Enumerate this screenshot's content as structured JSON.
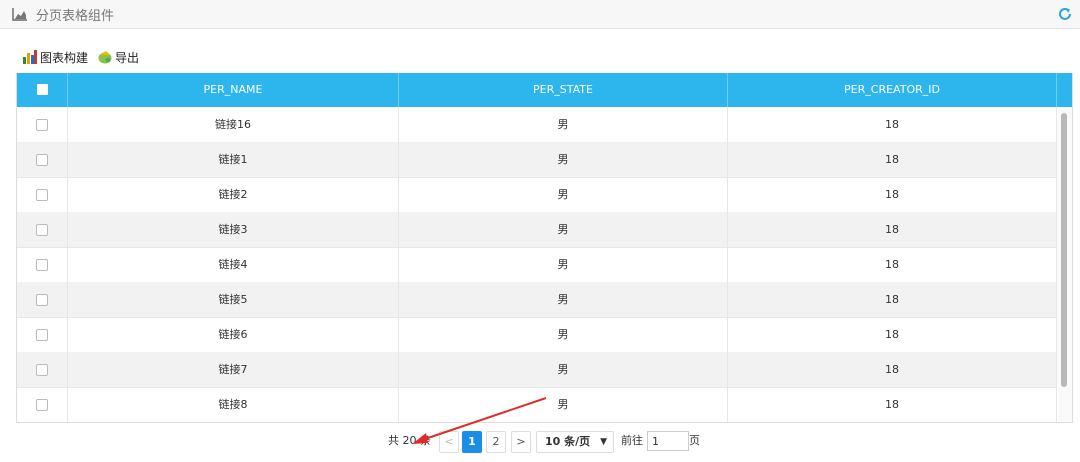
{
  "panel": {
    "title": "分页表格组件",
    "title_icon": "area-chart-icon",
    "refresh_icon": "refresh-icon"
  },
  "toolbar": {
    "chart_label": "图表构建",
    "chart_icon": "chart-build-icon",
    "export_label": "导出",
    "export_icon": "export-icon"
  },
  "table": {
    "columns": [
      "PER_NAME",
      "PER_STATE",
      "PER_CREATOR_ID"
    ],
    "rows": [
      [
        "链接16",
        "男",
        "18"
      ],
      [
        "链接1",
        "男",
        "18"
      ],
      [
        "链接2",
        "男",
        "18"
      ],
      [
        "链接3",
        "男",
        "18"
      ],
      [
        "链接4",
        "男",
        "18"
      ],
      [
        "链接5",
        "男",
        "18"
      ],
      [
        "链接6",
        "男",
        "18"
      ],
      [
        "链接7",
        "男",
        "18"
      ],
      [
        "链接8",
        "男",
        "18"
      ]
    ]
  },
  "pagination": {
    "total_text": "共 20 条",
    "prev": "<",
    "pages": [
      "1",
      "2"
    ],
    "current_page": "1",
    "next": ">",
    "page_size": "10 条/页",
    "goto_label": "前往",
    "goto_value": "1",
    "goto_unit": "页"
  },
  "colors": {
    "header": "#2db5ee",
    "active_page": "#1a8ee6",
    "annotation_arrow": "#e02b2b"
  }
}
